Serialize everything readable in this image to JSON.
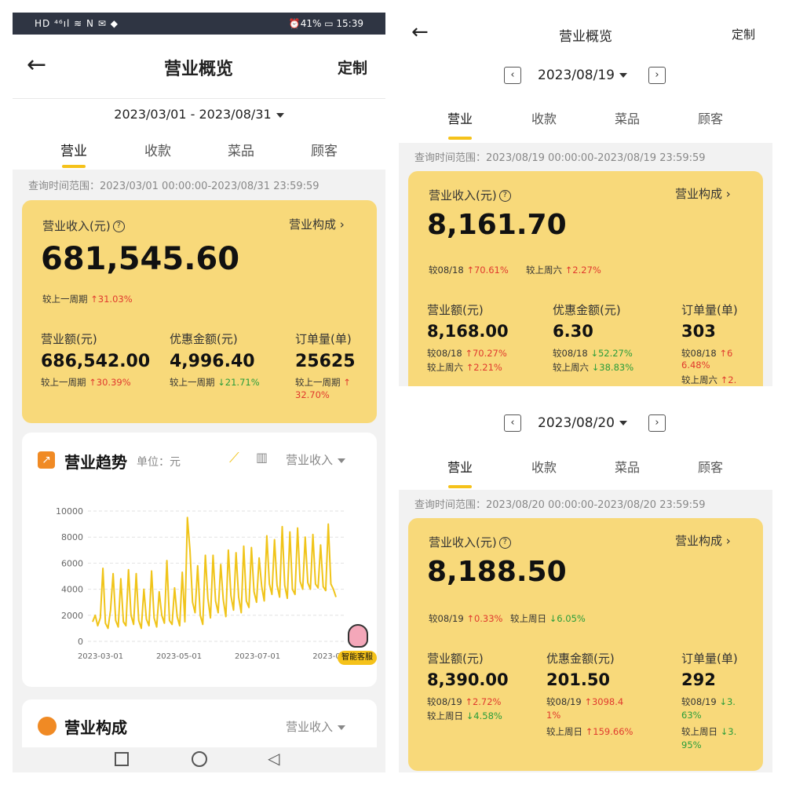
{
  "left": {
    "status": {
      "left": "HD ⁴⁶ıl ≋ N ✉ ◆",
      "right": "⏰41% ▭ 15:39"
    },
    "nav": {
      "title": "营业概览",
      "right": "定制",
      "back": "←"
    },
    "date_range": "2023/03/01 - 2023/08/31",
    "tabs": [
      "营业",
      "收款",
      "菜品",
      "顾客"
    ],
    "query_range": "查询时间范围：2023/03/01 00:00:00-2023/08/31 23:59:59",
    "summary": {
      "revenue_label": "营业收入(元)",
      "breakdown_link": "营业构成",
      "revenue_value": "681,545.60",
      "compare_label": "较上一周期",
      "compare_value": "31.03%",
      "metrics": [
        {
          "label": "营业额(元)",
          "value": "686,542.00",
          "cmp_label": "较上一周期",
          "cmp_value": "30.39%",
          "dir": "up"
        },
        {
          "label": "优惠金额(元)",
          "value": "4,996.40",
          "cmp_label": "较上一周期",
          "cmp_value": "21.71%",
          "dir": "down"
        },
        {
          "label": "订单量(单)",
          "value": "25625",
          "cmp_label": "较上一周期",
          "cmp_value": "32.70%",
          "dir": "up"
        }
      ]
    },
    "trend": {
      "title": "营业趋势",
      "unit": "单位：元",
      "metric_select": "营业收入",
      "assistant": "智能客服"
    },
    "composition": {
      "title": "营业构成",
      "metric_select": "营业收入"
    }
  },
  "chart_data": {
    "type": "line",
    "ylim": [
      0,
      10000
    ],
    "yticks": [
      "10000",
      "8000",
      "6000",
      "4000",
      "2000",
      "0"
    ],
    "xticks": [
      "2023-03-01",
      "2023-05-01",
      "2023-07-01",
      "2023-0"
    ],
    "color": "#f0c419",
    "series": [
      {
        "values": [
          1500,
          2000,
          1200,
          1800,
          5600,
          1400,
          1000,
          2400,
          5200,
          1600,
          1100,
          4800,
          1500,
          1200,
          5500,
          2000,
          1300,
          5200,
          1600,
          1000,
          4000,
          1700,
          1200,
          5400,
          1800,
          1100,
          3800,
          2000,
          1400,
          6200,
          1600,
          1300,
          4100,
          1900,
          1200,
          5300,
          1500,
          9500,
          7000,
          3000,
          2200,
          5800,
          2000,
          1300,
          6600,
          3300,
          1800,
          6600,
          3100,
          2200,
          5900,
          3200,
          1900,
          7000,
          3500,
          2400,
          6800,
          3400,
          2200,
          7300,
          3100,
          2600,
          7200,
          3800,
          3000,
          6400,
          4200,
          3100,
          8100,
          4400,
          3600,
          7800,
          4300,
          3400,
          8800,
          4300,
          3300,
          8400,
          4000,
          3600,
          8700,
          4600,
          4000,
          8000,
          4500,
          4000,
          8200,
          4400,
          4100,
          7400,
          4200,
          3900,
          9000,
          4400,
          4000,
          3400
        ]
      }
    ]
  },
  "right": {
    "nav": {
      "title": "营业概览",
      "right": "定制",
      "back": "←"
    },
    "sections": [
      {
        "date": "2023/08/19",
        "tabs": [
          "营业",
          "收款",
          "菜品",
          "顾客"
        ],
        "query_range": "查询时间范围：2023/08/19 00:00:00-2023/08/19 23:59:59",
        "revenue_label": "营业收入(元)",
        "breakdown_link": "营业构成",
        "revenue_value": "8,161.70",
        "compare": [
          {
            "label": "较08/18",
            "value": "70.61%",
            "dir": "up"
          },
          {
            "label": "较上周六",
            "value": "2.27%",
            "dir": "up"
          }
        ],
        "metrics": [
          {
            "label": "营业额(元)",
            "value": "8,168.00",
            "c1_label": "较08/18",
            "c1": "70.27%",
            "c1_dir": "up",
            "c2_label": "较上周六",
            "c2": "2.21%",
            "c2_dir": "up"
          },
          {
            "label": "优惠金额(元)",
            "value": "6.30",
            "c1_label": "较08/18",
            "c1": "52.27%",
            "c1_dir": "down",
            "c2_label": "较上周六",
            "c2": "38.83%",
            "c2_dir": "down"
          },
          {
            "label": "订单量(单)",
            "value": "303",
            "c1_label": "较08/18",
            "c1": "6",
            "c1_cont": "6.48%",
            "c1_dir": "up",
            "c2_label": "较上周六",
            "c2": "2.",
            "c2_dir": "up"
          }
        ]
      },
      {
        "date": "2023/08/20",
        "tabs": [
          "营业",
          "收款",
          "菜品",
          "顾客"
        ],
        "query_range": "查询时间范围：2023/08/20 00:00:00-2023/08/20 23:59:59",
        "revenue_label": "营业收入(元)",
        "breakdown_link": "营业构成",
        "revenue_value": "8,188.50",
        "compare": [
          {
            "label": "较08/19",
            "value": "0.33%",
            "dir": "up"
          },
          {
            "label": "较上周日",
            "value": "6.05%",
            "dir": "down"
          }
        ],
        "metrics": [
          {
            "label": "营业额(元)",
            "value": "8,390.00",
            "c1_label": "较08/19",
            "c1": "2.72%",
            "c1_dir": "up",
            "c2_label": "较上周日",
            "c2": "4.58%",
            "c2_dir": "down"
          },
          {
            "label": "优惠金额(元)",
            "value": "201.50",
            "c1_label": "较08/19",
            "c1": "3098.4",
            "c1_cont": "1%",
            "c1_dir": "up",
            "c2_label": "较上周日",
            "c2": "159.66%",
            "c2_dir": "up"
          },
          {
            "label": "订单量(单)",
            "value": "292",
            "c1_label": "较08/19",
            "c1": "3.",
            "c1_cont": "63%",
            "c1_dir": "down",
            "c2_label": "较上周日",
            "c2": "3.",
            "c2_cont": "95%",
            "c2_dir": "down"
          }
        ]
      }
    ]
  }
}
